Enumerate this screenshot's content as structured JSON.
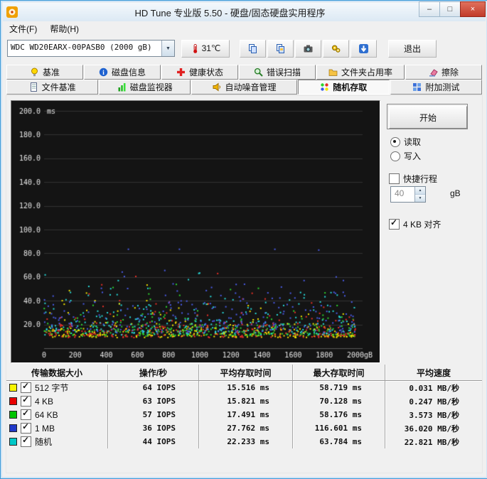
{
  "window": {
    "title": "HD Tune 专业版 5.50 - 硬盘/固态硬盘实用程序",
    "minimize": "–",
    "maximize": "□",
    "close": "×"
  },
  "menu": {
    "file": "文件(F)",
    "help": "帮助(H)"
  },
  "toolbar": {
    "drive": "WDC WD20EARX-00PASB0 (2000 gB)",
    "temperature": "31℃",
    "exit": "退出"
  },
  "tabs": {
    "row1": [
      "基准",
      "磁盘信息",
      "健康状态",
      "错误扫描",
      "文件夹占用率",
      "擦除"
    ],
    "row2": [
      "文件基准",
      "磁盘监视器",
      "自动噪音管理",
      "随机存取",
      "附加测试"
    ],
    "active": "随机存取"
  },
  "controls": {
    "start": "开始",
    "read": "读取",
    "write": "写入",
    "read_selected": true,
    "write_selected": false,
    "quick": "快捷行程",
    "quick_enabled": false,
    "quick_value": "40",
    "quick_unit": "gB",
    "align": "4 KB 对齐",
    "align_enabled": true
  },
  "chart_data": {
    "type": "scatter",
    "title": "随机存取 (random access test)",
    "ylabel": "ms",
    "xlabel_suffix": "gB",
    "xlim": [
      0,
      2000
    ],
    "ylim": [
      0,
      200
    ],
    "xticks": [
      0,
      200,
      400,
      600,
      800,
      1000,
      1200,
      1400,
      1600,
      1800,
      2000
    ],
    "yticks": [
      20,
      40,
      60,
      80,
      100,
      120,
      140,
      160,
      180,
      200
    ],
    "grid": true,
    "legend_position": "none",
    "series": [
      {
        "name": "512 字节",
        "color": "#f2e400",
        "avg_ms": 15.516,
        "max_ms": 58.719,
        "min_ms": 9,
        "points": 260
      },
      {
        "name": "4 KB",
        "color": "#e83028",
        "avg_ms": 15.821,
        "max_ms": 70.128,
        "min_ms": 9,
        "points": 260
      },
      {
        "name": "64 KB",
        "color": "#2ed32e",
        "avg_ms": 17.491,
        "max_ms": 58.176,
        "min_ms": 10,
        "points": 260
      },
      {
        "name": "1 MB",
        "color": "#4a5ce8",
        "avg_ms": 27.762,
        "max_ms": 116.601,
        "min_ms": 13,
        "points": 260
      },
      {
        "name": "随机",
        "color": "#28d8d8",
        "avg_ms": 22.233,
        "max_ms": 63.784,
        "min_ms": 11,
        "points": 260
      }
    ]
  },
  "table": {
    "headers": [
      "传输数据大小",
      "操作/秒",
      "平均存取时间",
      "最大存取时间",
      "平均速度"
    ],
    "rows": [
      {
        "swatch": "#f8f400",
        "checked": true,
        "label": "512 字节",
        "ops": "64 IOPS",
        "avg": "15.516 ms",
        "max": "58.719 ms",
        "speed": "0.031 MB/秒"
      },
      {
        "swatch": "#e80000",
        "checked": true,
        "label": "4 KB",
        "ops": "63 IOPS",
        "avg": "15.821 ms",
        "max": "70.128 ms",
        "speed": "0.247 MB/秒"
      },
      {
        "swatch": "#00c400",
        "checked": true,
        "label": "64 KB",
        "ops": "57 IOPS",
        "avg": "17.491 ms",
        "max": "58.176 ms",
        "speed": "3.573 MB/秒"
      },
      {
        "swatch": "#2038c8",
        "checked": true,
        "label": "1 MB",
        "ops": "36 IOPS",
        "avg": "27.762 ms",
        "max": "116.601 ms",
        "speed": "36.020 MB/秒"
      },
      {
        "swatch": "#00c8c8",
        "checked": true,
        "label": "随机",
        "ops": "44 IOPS",
        "avg": "22.233 ms",
        "max": "63.784 ms",
        "speed": "22.821 MB/秒"
      }
    ]
  }
}
